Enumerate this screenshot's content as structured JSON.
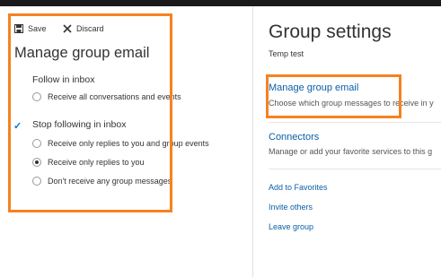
{
  "toolbar": {
    "save_label": "Save",
    "discard_label": "Discard"
  },
  "manage_panel": {
    "title": "Manage group email",
    "follow_section": {
      "label": "Follow in inbox",
      "options": [
        {
          "label": "Receive all conversations and events",
          "selected": false
        }
      ]
    },
    "stop_section": {
      "label": "Stop following in inbox",
      "checkmark": "✓",
      "options": [
        {
          "label": "Receive only replies to you and group events",
          "selected": false
        },
        {
          "label": "Receive only replies to you",
          "selected": true
        },
        {
          "label": "Don't receive any group messages",
          "selected": false
        }
      ]
    }
  },
  "group_settings": {
    "title": "Group settings",
    "group_name": "Temp test",
    "manage_email": {
      "title": "Manage group email",
      "description": "Choose which group messages to receive in y"
    },
    "connectors": {
      "title": "Connectors",
      "description": "Manage or add your favorite services to this g"
    },
    "links": {
      "add_favorites": "Add to Favorites",
      "invite_others": "Invite others",
      "leave_group": "Leave group"
    }
  },
  "colors": {
    "highlight": "#f58220",
    "link": "#0b5ea6",
    "check": "#0078d4",
    "topbar": "#1a1a1a"
  }
}
